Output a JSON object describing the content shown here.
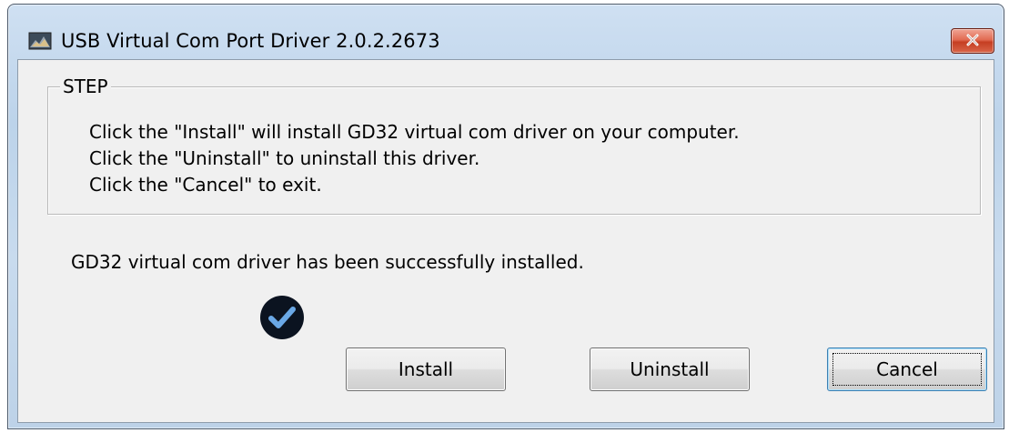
{
  "window": {
    "title": "USB Virtual Com Port Driver 2.0.2.2673",
    "app_icon": "installer-icon",
    "close_icon": "close-icon"
  },
  "step_group": {
    "legend": "STEP",
    "lines": [
      "Click the \"Install\" will install GD32 virtual com driver on your computer.",
      "Click the \"Uninstall\" to uninstall this driver.",
      "Click the \"Cancel\" to exit."
    ]
  },
  "status": {
    "message": "GD32 virtual com driver has been successfully installed.",
    "icon": "checkmark-icon"
  },
  "buttons": {
    "install": "Install",
    "uninstall": "Uninstall",
    "cancel": "Cancel"
  },
  "colors": {
    "close_button": "#c53e22",
    "client_background": "#f0f0f0",
    "check_circle": "#0b1320",
    "check_mark": "#6aa8e6"
  }
}
